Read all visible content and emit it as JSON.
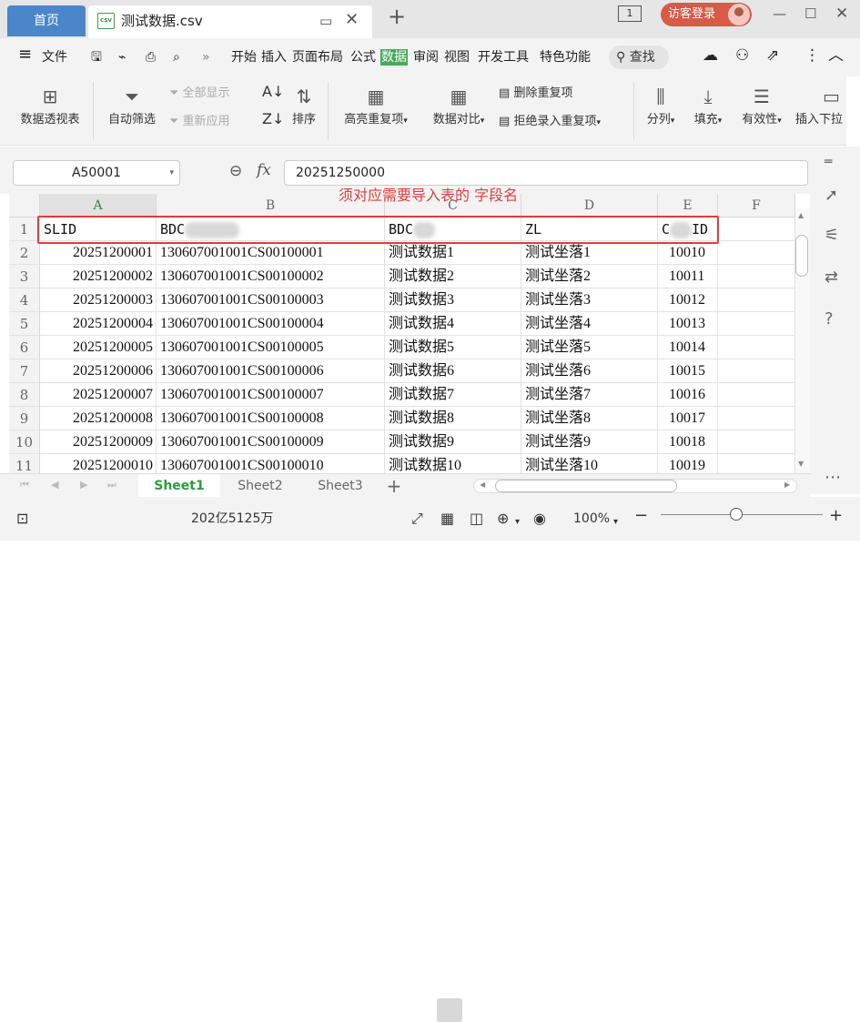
{
  "titlebar": {
    "home_tab": "首页",
    "file_tab": "测试数据.csv",
    "file_icon_text": "csv",
    "add_tab": "+",
    "page_badge": "1",
    "login_label": "访客登录",
    "icons": [
      "monitor-icon",
      "close-tab-icon",
      "add-tab-icon",
      "minimize-icon",
      "maximize-icon",
      "close-window-icon"
    ]
  },
  "menu": {
    "file_label": "文件",
    "items": [
      "开始",
      "插入",
      "页面布局",
      "公式",
      "数据",
      "审阅",
      "视图",
      "开发工具",
      "特色功能"
    ],
    "active": "数据",
    "search_label": "查找",
    "more_glyph": "»"
  },
  "ribbon": {
    "pivot": "数据透视表",
    "autofilter": "自动筛选",
    "show_all": "全部显示",
    "reapply": "重新应用",
    "sort": "排序",
    "highlight_dup": "高亮重复项",
    "compare": "数据对比",
    "remove_dup": "删除重复项",
    "reject_dup": "拒绝录入重复项",
    "split": "分列",
    "fill": "填充",
    "validity": "有效性",
    "dropdown": "插入下拉"
  },
  "formula_bar": {
    "cell_ref": "A50001",
    "fx": "fx",
    "value": "20251250000"
  },
  "grid": {
    "columns": [
      "A",
      "B",
      "C",
      "D",
      "E",
      "F"
    ],
    "selected_column": "A",
    "header_row": {
      "row": "1",
      "cells": [
        "SLID",
        "BDC",
        "BDC",
        "ZL",
        "C",
        "ID"
      ]
    },
    "rows": [
      {
        "row": "2",
        "a": "20251200001",
        "b": "130607001001CS00100001",
        "c": "测试数据1",
        "d": "测试坐落1",
        "e": "10010"
      },
      {
        "row": "3",
        "a": "20251200002",
        "b": "130607001001CS00100002",
        "c": "测试数据2",
        "d": "测试坐落2",
        "e": "10011"
      },
      {
        "row": "4",
        "a": "20251200003",
        "b": "130607001001CS00100003",
        "c": "测试数据3",
        "d": "测试坐落3",
        "e": "10012"
      },
      {
        "row": "5",
        "a": "20251200004",
        "b": "130607001001CS00100004",
        "c": "测试数据4",
        "d": "测试坐落4",
        "e": "10013"
      },
      {
        "row": "6",
        "a": "20251200005",
        "b": "130607001001CS00100005",
        "c": "测试数据5",
        "d": "测试坐落5",
        "e": "10014"
      },
      {
        "row": "7",
        "a": "20251200006",
        "b": "130607001001CS00100006",
        "c": "测试数据6",
        "d": "测试坐落6",
        "e": "10015"
      },
      {
        "row": "8",
        "a": "20251200007",
        "b": "130607001001CS00100007",
        "c": "测试数据7",
        "d": "测试坐落7",
        "e": "10016"
      },
      {
        "row": "9",
        "a": "20251200008",
        "b": "130607001001CS00100008",
        "c": "测试数据8",
        "d": "测试坐落8",
        "e": "10017"
      },
      {
        "row": "10",
        "a": "20251200009",
        "b": "130607001001CS00100009",
        "c": "测试数据9",
        "d": "测试坐落9",
        "e": "10018"
      },
      {
        "row": "11",
        "a": "20251200010",
        "b": "130607001001CS00100010",
        "c": "测试数据10",
        "d": "测试坐落10",
        "e": "10019"
      }
    ]
  },
  "annotation": {
    "text": "须对应需要导入表的 字段名",
    "color": "#e23c3c"
  },
  "sheets": {
    "tabs": [
      "Sheet1",
      "Sheet2",
      "Sheet3"
    ],
    "active": "Sheet1",
    "add": "+"
  },
  "status": {
    "count": "202亿5125万",
    "zoom": "100%",
    "zoom_out": "−",
    "zoom_in": "+",
    "zoom_level": 0.5
  },
  "colors": {
    "accent_green": "#4aa85a",
    "home_tab_blue": "#4a86c8",
    "login_red": "#d85a47"
  }
}
